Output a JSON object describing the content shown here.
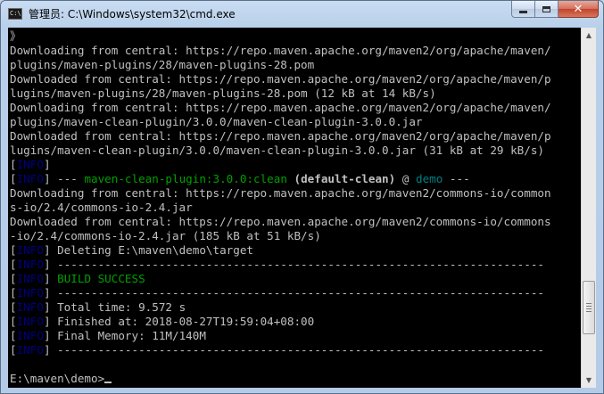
{
  "window": {
    "title": "管理员: C:\\Windows\\system32\\cmd.exe",
    "icon": "cmd-icon",
    "icon_text": "C:\\",
    "minimize_icon": "minimize-icon",
    "maximize_icon": "maximize-icon",
    "close_label": "✕"
  },
  "console": {
    "lines": [
      {
        "parts": [
          {
            "text": "》",
            "style": "plain"
          }
        ]
      },
      {
        "parts": [
          {
            "text": "Downloading from central: https://repo.maven.apache.org/maven2/org/apache/maven/",
            "style": "plain"
          }
        ]
      },
      {
        "parts": [
          {
            "text": "plugins/maven-plugins/28/maven-plugins-28.pom",
            "style": "plain"
          }
        ]
      },
      {
        "parts": [
          {
            "text": "Downloaded from central: https://repo.maven.apache.org/maven2/org/apache/maven/p",
            "style": "plain"
          }
        ]
      },
      {
        "parts": [
          {
            "text": "lugins/maven-plugins/28/maven-plugins-28.pom (12 kB at 14 kB/s)",
            "style": "plain"
          }
        ]
      },
      {
        "parts": [
          {
            "text": "Downloading from central: https://repo.maven.apache.org/maven2/org/apache/maven/",
            "style": "plain"
          }
        ]
      },
      {
        "parts": [
          {
            "text": "plugins/maven-clean-plugin/3.0.0/maven-clean-plugin-3.0.0.jar",
            "style": "plain"
          }
        ]
      },
      {
        "parts": [
          {
            "text": "Downloaded from central: https://repo.maven.apache.org/maven2/org/apache/maven/p",
            "style": "plain"
          }
        ]
      },
      {
        "parts": [
          {
            "text": "lugins/maven-clean-plugin/3.0.0/maven-clean-plugin-3.0.0.jar (31 kB at 29 kB/s)",
            "style": "plain"
          }
        ]
      },
      {
        "parts": [
          {
            "text": "[",
            "style": "plain"
          },
          {
            "text": "INFO",
            "style": "tag"
          },
          {
            "text": "]",
            "style": "plain"
          }
        ]
      },
      {
        "parts": [
          {
            "text": "[",
            "style": "plain"
          },
          {
            "text": "INFO",
            "style": "tag"
          },
          {
            "text": "] --- ",
            "style": "plain"
          },
          {
            "text": "maven-clean-plugin:3.0.0:clean",
            "style": "green"
          },
          {
            "text": " (default-clean)",
            "style": "bold"
          },
          {
            "text": " @ ",
            "style": "plain"
          },
          {
            "text": "demo",
            "style": "cyan"
          },
          {
            "text": " ---",
            "style": "plain"
          }
        ]
      },
      {
        "parts": [
          {
            "text": "Downloading from central: https://repo.maven.apache.org/maven2/commons-io/common",
            "style": "plain"
          }
        ]
      },
      {
        "parts": [
          {
            "text": "s-io/2.4/commons-io-2.4.jar",
            "style": "plain"
          }
        ]
      },
      {
        "parts": [
          {
            "text": "Downloaded from central: https://repo.maven.apache.org/maven2/commons-io/commons",
            "style": "plain"
          }
        ]
      },
      {
        "parts": [
          {
            "text": "-io/2.4/commons-io-2.4.jar (185 kB at 51 kB/s)",
            "style": "plain"
          }
        ]
      },
      {
        "parts": [
          {
            "text": "[",
            "style": "plain"
          },
          {
            "text": "INFO",
            "style": "tag"
          },
          {
            "text": "] Deleting E:\\maven\\demo\\target",
            "style": "plain"
          }
        ]
      },
      {
        "parts": [
          {
            "text": "[",
            "style": "plain"
          },
          {
            "text": "INFO",
            "style": "tag"
          },
          {
            "text": "] ------------------------------------------------------------------------",
            "style": "plain"
          }
        ]
      },
      {
        "parts": [
          {
            "text": "[",
            "style": "plain"
          },
          {
            "text": "INFO",
            "style": "tag"
          },
          {
            "text": "] ",
            "style": "plain"
          },
          {
            "text": "BUILD SUCCESS",
            "style": "green"
          }
        ]
      },
      {
        "parts": [
          {
            "text": "[",
            "style": "plain"
          },
          {
            "text": "INFO",
            "style": "tag"
          },
          {
            "text": "] ------------------------------------------------------------------------",
            "style": "plain"
          }
        ]
      },
      {
        "parts": [
          {
            "text": "[",
            "style": "plain"
          },
          {
            "text": "INFO",
            "style": "tag"
          },
          {
            "text": "] Total time: 9.572 s",
            "style": "plain"
          }
        ]
      },
      {
        "parts": [
          {
            "text": "[",
            "style": "plain"
          },
          {
            "text": "INFO",
            "style": "tag"
          },
          {
            "text": "] Finished at: 2018-08-27T19:59:04+08:00",
            "style": "plain"
          }
        ]
      },
      {
        "parts": [
          {
            "text": "[",
            "style": "plain"
          },
          {
            "text": "INFO",
            "style": "tag"
          },
          {
            "text": "] Final Memory: 11M/140M",
            "style": "plain"
          }
        ]
      },
      {
        "parts": [
          {
            "text": "[",
            "style": "plain"
          },
          {
            "text": "INFO",
            "style": "tag"
          },
          {
            "text": "] ------------------------------------------------------------------------",
            "style": "plain"
          }
        ]
      },
      {
        "parts": []
      },
      {
        "parts": [
          {
            "text": "E:\\maven\\demo>",
            "style": "plain"
          }
        ],
        "cursor": true
      }
    ]
  },
  "scrollbar": {
    "up_icon": "scroll-up-arrow-icon",
    "down_icon": "scroll-down-arrow-icon",
    "position": 0.86
  },
  "colors": {
    "console_bg": "#000000",
    "console_fg": "#c0c0c0",
    "info_tag": "#000080",
    "success": "#00a000",
    "project_name": "#008080"
  }
}
